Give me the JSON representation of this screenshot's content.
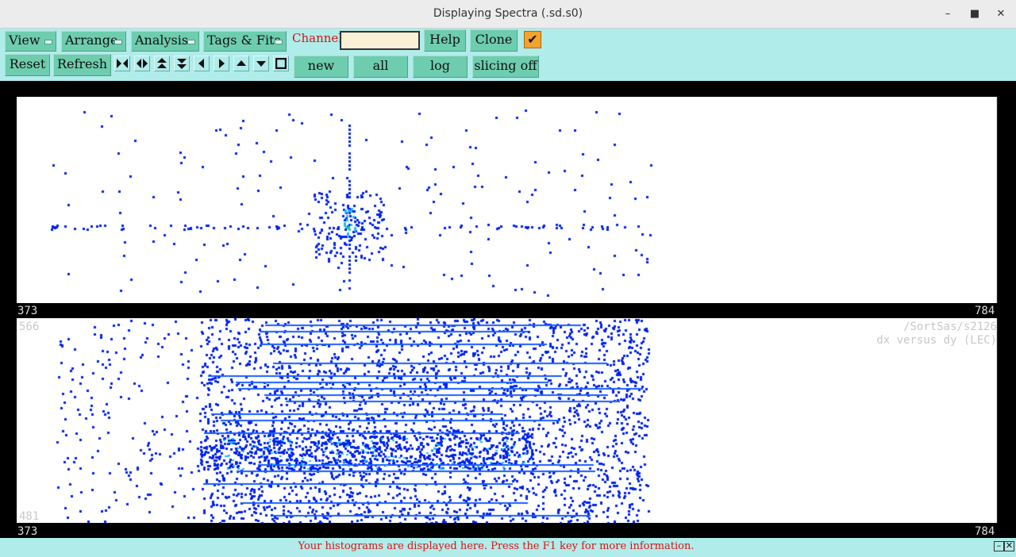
{
  "window": {
    "title": "Displaying Spectra (.sd.s0)",
    "controls": [
      "minimize-icon",
      "maximize-icon",
      "close-icon"
    ]
  },
  "toolbar": {
    "menus": [
      {
        "label": "View"
      },
      {
        "label": "Arrange"
      },
      {
        "label": "Analysis"
      },
      {
        "label": "Tags & Fits"
      }
    ],
    "channel_label": "Channel:",
    "channel_value": "",
    "help_label": "Help",
    "clone_label": "Clone",
    "checkbox_checked": true,
    "reset_label": "Reset",
    "refresh_label": "Refresh",
    "nav_icons": [
      "first-icon",
      "expand-horizontal-icon",
      "expand-up-icon",
      "expand-down-icon",
      "left-icon",
      "right-icon",
      "up-icon",
      "down-icon",
      "stop-icon"
    ],
    "new_label": "new",
    "all_label": "all",
    "log_label": "log",
    "slicing_label": "slicing off"
  },
  "plots": {
    "top": {
      "x_min_label": "373",
      "x_max_label": "784"
    },
    "bottom": {
      "x_min_label": "373",
      "x_max_label": "784",
      "y_max_label": "566",
      "y_min_label": "481",
      "spectrum_path": "/SortSas/s2126",
      "spectrum_title": "dx versus dy (LEC)"
    }
  },
  "colors": {
    "background": "#b0ecea",
    "button": "#6ecdae",
    "scatter": "#0022ee",
    "hot": "#22bbff",
    "status_text": "#dd1111"
  },
  "status": {
    "message": "Your histograms are displayed here. Press the F1 key for more information."
  }
}
